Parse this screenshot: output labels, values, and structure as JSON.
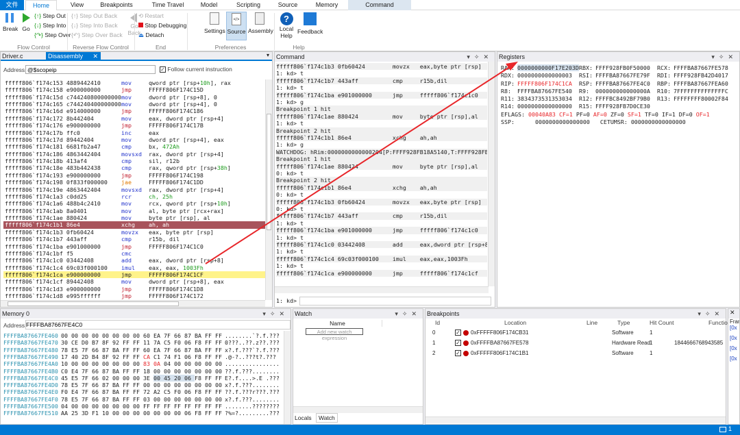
{
  "ribbon": {
    "file_tab": "文件",
    "tabs": [
      "Home",
      "View",
      "Breakpoints",
      "Time Travel",
      "Model",
      "Scripting",
      "Source",
      "Memory",
      "Command"
    ],
    "break": "Break",
    "go": "Go",
    "step_out": "Step Out",
    "step_into": "Step Into",
    "step_over": "Step Over",
    "step_out_back": "Step Out Back",
    "step_into_back": "Step Into Back",
    "step_over_back": "Step Over Back",
    "go_back": "Go Back",
    "restart": "Restart",
    "stop": "Stop Debugging",
    "detach": "Detach",
    "settings": "Settings",
    "source": "Source",
    "assembly": "Assembly",
    "local_help": "Local Help",
    "feedback": "Feedback",
    "groups": [
      "Flow Control",
      "Reverse Flow Control",
      "End",
      "Preferences",
      "Help"
    ]
  },
  "disasm": {
    "tabs": [
      "Driver.c",
      "Disassembly"
    ],
    "address_label": "Address:",
    "address_value": "@$scopeip",
    "follow_label": "Follow current instruction",
    "follow_checked": true,
    "rows": [
      {
        "a": "fffff806`f174c153 4889442410",
        "m": "mov",
        "c": "blue",
        "o": [
          "qword ptr [rsp+",
          "10h",
          "], rax"
        ]
      },
      {
        "a": "fffff806`f174c158 e900000000",
        "m": "jmp",
        "c": "red",
        "o": [
          "FFFFF806F174C15D",
          "",
          ""
        ]
      },
      {
        "a": "fffff806`f174c15d c744240800000000",
        "m": "mov",
        "c": "blue",
        "o": [
          "dword ptr [rsp+8], 0",
          "",
          ""
        ]
      },
      {
        "a": "fffff806`f174c165 c744240400000000",
        "m": "mov",
        "c": "blue",
        "o": [
          "dword ptr [rsp+4], 0",
          "",
          ""
        ]
      },
      {
        "a": "fffff806`f174c16d e914000000",
        "m": "jmp",
        "c": "red",
        "o": [
          "FFFFF806F174C186",
          "",
          ""
        ]
      },
      {
        "a": "fffff806`f174c172 8b442404",
        "m": "mov",
        "c": "blue",
        "o": [
          "eax, dword ptr [rsp+4]",
          "",
          ""
        ]
      },
      {
        "a": "fffff806`f174c176 e900000000",
        "m": "jmp",
        "c": "red",
        "o": [
          "FFFFF806F174C17B",
          "",
          ""
        ]
      },
      {
        "a": "fffff806`f174c17b ffc0",
        "m": "inc",
        "c": "blue",
        "o": [
          "eax",
          "",
          ""
        ]
      },
      {
        "a": "fffff806`f174c17d 89442404",
        "m": "mov",
        "c": "blue",
        "o": [
          "dword ptr [rsp+4], eax",
          "",
          ""
        ]
      },
      {
        "a": "fffff806`f174c181 6681fb2a47",
        "m": "cmp",
        "c": "blue",
        "o": [
          "bx, ",
          "472Ah",
          ""
        ]
      },
      {
        "a": "fffff806`f174c186 4863442404",
        "m": "movsxd",
        "c": "blue",
        "o": [
          "rax, dword ptr [rsp+4]",
          "",
          ""
        ]
      },
      {
        "a": "fffff806`f174c18b 413af4",
        "m": "cmp",
        "c": "blue",
        "o": [
          "sil, r12b",
          "",
          ""
        ]
      },
      {
        "a": "fffff806`f174c18e 483b442438",
        "m": "cmp",
        "c": "blue",
        "o": [
          "rax, qword ptr [rsp+",
          "38h",
          "]"
        ]
      },
      {
        "a": "fffff806`f174c193 e900000000",
        "m": "jmp",
        "c": "red",
        "o": [
          "FFFFF806F174C198",
          "",
          ""
        ]
      },
      {
        "a": "fffff806`f174c198 0f833f000000",
        "m": "jae",
        "c": "orange",
        "o": [
          "FFFFF806F174C1DD",
          "",
          ""
        ]
      },
      {
        "a": "fffff806`f174c19e 4863442404",
        "m": "movsxd",
        "c": "blue",
        "o": [
          "rax, dword ptr [rsp+4]",
          "",
          ""
        ]
      },
      {
        "a": "fffff806`f174c1a3 c0dd25",
        "m": "rcr",
        "c": "blue",
        "o": [
          "",
          "ch, 25h",
          ""
        ]
      },
      {
        "a": "fffff806`f174c1a6 488b4c2410",
        "m": "mov",
        "c": "blue",
        "o": [
          "rcx, qword ptr [rsp+",
          "10h",
          "]"
        ]
      },
      {
        "a": "fffff806`f174c1ab 8a0401",
        "m": "mov",
        "c": "blue",
        "o": [
          "al, byte ptr [rcx+rax]",
          "",
          ""
        ]
      },
      {
        "a": "fffff806`f174c1ae 880424",
        "m": "mov",
        "c": "blue",
        "o": [
          "byte ptr [rsp], al",
          "",
          ""
        ]
      },
      {
        "a": "fffff806`f174c1b1 86e4",
        "m": "xchg",
        "c": "blue",
        "o": [
          "ah, ah",
          "",
          ""
        ],
        "hl": "bp"
      },
      {
        "a": "fffff806`f174c1b3 0fb60424",
        "m": "movzx",
        "c": "blue",
        "o": [
          "eax, byte ptr [rsp]",
          "",
          ""
        ]
      },
      {
        "a": "fffff806`f174c1b7 443aff",
        "m": "cmp",
        "c": "blue",
        "o": [
          "r15b, dil",
          "",
          ""
        ]
      },
      {
        "a": "fffff806`f174c1ba e901000000",
        "m": "jmp",
        "c": "red",
        "o": [
          "FFFFF806F174C1C0",
          "",
          ""
        ]
      },
      {
        "a": "fffff806`f174c1bf f5",
        "m": "cmc",
        "c": "blue",
        "o": [
          "",
          "",
          ""
        ]
      },
      {
        "a": "fffff806`f174c1c0 03442408",
        "m": "add",
        "c": "blue",
        "o": [
          "eax, dword ptr [rsp+8]",
          "",
          ""
        ]
      },
      {
        "a": "fffff806`f174c1c4 69c03f000100",
        "m": "imul",
        "c": "blue",
        "o": [
          "eax, eax, ",
          "1003Fh",
          ""
        ]
      },
      {
        "a": "fffff806`f174c1ca e900000000",
        "m": "jmp",
        "c": "red",
        "o": [
          "FFFFF806F174C1CF",
          "",
          ""
        ],
        "hl": "cur"
      },
      {
        "a": "fffff806`f174c1cf 89442408",
        "m": "mov",
        "c": "blue",
        "o": [
          "dword ptr [rsp+8], eax",
          "",
          ""
        ]
      },
      {
        "a": "fffff806`f174c1d3 e900000000",
        "m": "jmp",
        "c": "red",
        "o": [
          "FFFFF806F174C1D8",
          "",
          ""
        ]
      },
      {
        "a": "fffff806`f174c1d8 e995ffffff",
        "m": "jmp",
        "c": "red",
        "o": [
          "FFFFF806F174C172",
          "",
          ""
        ]
      }
    ]
  },
  "command": {
    "title": "Command",
    "prompt": "1: kd>",
    "lines": [
      {
        "t": "fffff806`f174c1b3 0fb60424        movzx   eax,byte ptr [rsp]",
        "k": "out"
      },
      {
        "t": "1: kd> t",
        "k": "in"
      },
      {
        "t": "fffff806`f174c1b7 443aff          cmp     r15b,dil",
        "k": "out"
      },
      {
        "t": "1: kd> t",
        "k": "in"
      },
      {
        "t": "fffff806`f174c1ba e901000000      jmp     fffff806`f174c1c0",
        "k": "out"
      },
      {
        "t": "1: kd> g",
        "k": "in"
      },
      {
        "t": "Breakpoint 1 hit",
        "k": "out"
      },
      {
        "t": "fffff806`f174c1ae 880424          mov     byte ptr [rsp],al",
        "k": "out"
      },
      {
        "t": "1: kd> t",
        "k": "in"
      },
      {
        "t": "Breakpoint 2 hit",
        "k": "out"
      },
      {
        "t": "fffff806`f174c1b1 86e4            xchg    ah,ah",
        "k": "out"
      },
      {
        "t": "1: kd> g",
        "k": "in"
      },
      {
        "t": "WATCHDOG: hRim:0000000000000204[P:FFFF928FB18A5140,T:FFFF928FB:",
        "k": "out"
      },
      {
        "t": "Breakpoint 1 hit",
        "k": "out"
      },
      {
        "t": "fffff806`f174c1ae 880424          mov     byte ptr [rsp],al",
        "k": "out"
      },
      {
        "t": "0: kd> t",
        "k": "in"
      },
      {
        "t": "Breakpoint 2 hit",
        "k": "out"
      },
      {
        "t": "fffff806`f174c1b1 86e4            xchg    ah,ah",
        "k": "out"
      },
      {
        "t": "0: kd> t",
        "k": "in"
      },
      {
        "t": "fffff806`f174c1b3 0fb60424        movzx   eax,byte ptr [rsp]",
        "k": "out"
      },
      {
        "t": "0: kd> t",
        "k": "in"
      },
      {
        "t": "fffff806`f174c1b7 443aff          cmp     r15b,dil",
        "k": "out"
      },
      {
        "t": "1: kd> t",
        "k": "in"
      },
      {
        "t": "fffff806`f174c1ba e901000000      jmp     fffff806`f174c1c0",
        "k": "out"
      },
      {
        "t": "1: kd> t",
        "k": "in"
      },
      {
        "t": "fffff806`f174c1c0 03442408        add     eax,dword ptr [rsp+8]",
        "k": "out"
      },
      {
        "t": "1: kd> t",
        "k": "in"
      },
      {
        "t": "fffff806`f174c1c4 69c03f000100    imul    eax,eax,1003Fh",
        "k": "out"
      },
      {
        "t": "1: kd> t",
        "k": "in"
      },
      {
        "t": "fffff806`f174c1ca e900000000      jmp     fffff806`f174c1cf",
        "k": "out"
      }
    ]
  },
  "registers": {
    "title": "Registers",
    "rows": [
      [
        [
          "RAX:",
          "0000000000F17E203D"
        ],
        [
          "RBX:",
          "FFFF928FB0F50000"
        ],
        [
          "RCX:",
          "FFFFBA87667FE578"
        ]
      ],
      [
        [
          "RDX:",
          "0000000000000003"
        ],
        [
          "RSI:",
          "FFFFBA87667FE79F"
        ],
        [
          "RDI:",
          "FFFF928FB42D4017"
        ]
      ],
      [
        [
          "RIP:",
          "FFFFF806F174C1CA"
        ],
        [
          "RSP:",
          "FFFFBA87667FE4C0"
        ],
        [
          "RBP:",
          "FFFFBA87667FEA60"
        ]
      ],
      [
        [
          "R8: ",
          "FFFFBA87667FE540"
        ],
        [
          "R9: ",
          "000000000000000A"
        ],
        [
          "R10:",
          "7FFFFFFFFFFFFFFC"
        ]
      ],
      [
        [
          "R11:",
          "3834373531353034"
        ],
        [
          "R12:",
          "FFFFBC8492BF79B0"
        ],
        [
          "R13:",
          "FFFFFFFF80002F84"
        ]
      ],
      [
        [
          "R14:",
          "0000000000000000"
        ],
        [
          "R15:",
          "FFFF928FB7D0CE30"
        ]
      ]
    ],
    "eflags": [
      {
        "t": "EFLAGS: "
      },
      {
        "t": "00040A83",
        "r": 1
      },
      {
        "t": " "
      },
      {
        "t": "CF=1",
        "r": 1
      },
      {
        "t": " PF=0 "
      },
      {
        "t": "AF=0",
        "r": 1
      },
      {
        "t": " ZF=0 "
      },
      {
        "t": "SF=1",
        "r": 1
      },
      {
        "t": " TF=0 IF=1 DF=0 "
      },
      {
        "t": "OF=1",
        "r": 1
      }
    ],
    "ssp": "SSP:      0000000000000000   CETUMSR: 0000000000000000"
  },
  "memory": {
    "title": "Memory 0",
    "address_label": "Address:",
    "address_value": "FFFFBA87667FE4C0",
    "rows": [
      {
        "a": "FFFFBA87667FE460",
        "h": "00 00 00 00 00 00 00 00 60 EA 7F 66 87 BA FF FF",
        "s": "........`?.f.???"
      },
      {
        "a": "FFFFBA87667FE470",
        "h": "30 CE D0 B7 8F 92 FF FF 11 7A C5 F0 06 F8 FF FF",
        "s": "0???..??.z??.???"
      },
      {
        "a": "FFFFBA87667FE480",
        "h": "78 E5 7F 66 87 BA FF FF 60 EA 7F 66 87 BA FF FF",
        "s": "x?.f.???`?.f.???"
      },
      {
        "a": "FFFFBA87667FE490",
        "h": "17 40 2D B4 8F 92 FF FF CA C1 74 F1 06 F8 FF FF",
        "s": ".@-?..???t?.???"
      },
      {
        "a": "FFFFBA87667FE4A0",
        "h": "10 00 00 00 00 00 00 00 83 0A 04 00 00 00 00 00",
        "s": "................"
      },
      {
        "a": "FFFFBA87667FE4B0",
        "h": "C0 E4 7F 66 87 BA FF FF 18 00 00 00 00 00 00 00",
        "s": "??.f.???........"
      },
      {
        "a": "FFFFBA87667FE4C0",
        "h": "45 E5 7F 66 02 00 00 00 3E 00 45 20 06 F8 FF FF",
        "s": "E?.f....>.E .???"
      },
      {
        "a": "FFFFBA87667FE4D0",
        "h": "78 E5 7F 66 87 BA FF FF 00 00 00 00 00 00 00 00",
        "s": "x?.f.???........"
      },
      {
        "a": "FFFFBA87667FE4E0",
        "h": "F0 E4 7F 66 87 BA FF FF 72 A2 C5 F0 06 F8 FF FF",
        "s": "??.f.???r???.???"
      },
      {
        "a": "FFFFBA87667FE4F0",
        "h": "78 E5 7F 66 87 BA FF FF 03 00 00 00 00 00 00 00",
        "s": "x?.f.???........"
      },
      {
        "a": "FFFFBA87667FE500",
        "h": "04 00 00 00 00 00 00 00 FF FF FF FF FF FF FF FF",
        "s": "........????????"
      },
      {
        "a": "FFFFBA87667FE510",
        "h": "AA 25 3D F1 10 00 00 00 00 00 00 00 06 F8 FF FF",
        "s": "?%=?.........???"
      }
    ]
  },
  "watch": {
    "title": "Watch",
    "col_name": "Name",
    "placeholder": "Add new watch expression",
    "tabs": [
      "Locals",
      "Watch"
    ]
  },
  "breakpoints": {
    "title": "Breakpoints",
    "columns": [
      "Id",
      "Location",
      "Line",
      "Type",
      "Hit Count",
      "Functio"
    ],
    "rows": [
      {
        "id": "0",
        "loc": "0xFFFFF806F174CB31",
        "line": "",
        "type": "Software",
        "hits": "1",
        "func": ""
      },
      {
        "id": "1",
        "loc": "0xFFFFBA87667FE578",
        "line": "",
        "type": "Hardware Read",
        "hits": "1",
        "func": "1844666768943585"
      },
      {
        "id": "2",
        "loc": "0xFFFFF806F174C1B1",
        "line": "",
        "type": "Software",
        "hits": "1",
        "func": ""
      }
    ]
  },
  "frames": {
    "title": "Fram",
    "items": [
      "[0x",
      "[0x",
      "[0x",
      "[0x"
    ]
  },
  "status": {
    "notifications": "1"
  },
  "colors": {
    "accent": "#0078d4",
    "breakpoint_row": "#a8545c",
    "current_row": "#fff38a",
    "bp_dot": "#c40000",
    "addr": "#2b91af"
  }
}
